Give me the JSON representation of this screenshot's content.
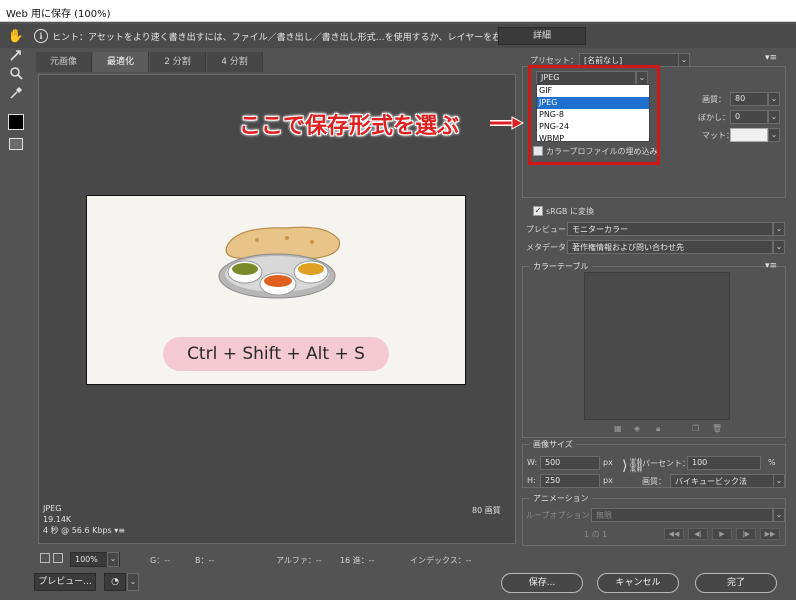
{
  "window": {
    "title": "Web 用に保存 (100%)"
  },
  "hint": {
    "text": "ヒント：アセットをより速く書き出すには、ファイル／書き出し／書き出し形式…を使用するか、レイヤーを右クリックして使用。",
    "detail_button": "詳細"
  },
  "tabs": [
    "元画像",
    "最適化",
    "2 分割",
    "4 分割"
  ],
  "preview": {
    "shortcut_text": "Ctrl + Shift + Alt + S"
  },
  "image_info": {
    "format": "JPEG",
    "size": "19.14K",
    "speed": "4 秒 @ 56.6 Kbps",
    "quality": "80 画質"
  },
  "callout": {
    "text": "ここで保存形式を選ぶ",
    "color": "#e02020"
  },
  "settings": {
    "preset_label": "プリセット：",
    "preset_value": "[名前なし]",
    "format_value": "JPEG",
    "format_options": [
      "GIF",
      "JPEG",
      "PNG-8",
      "PNG-24",
      "WBMP"
    ],
    "quality_label": "画質：",
    "quality_value": "80",
    "blur_label": "ぼかし：",
    "blur_value": "0",
    "matte_label": "マット：",
    "embed_profile_label": "カラープロファイルの埋め込み",
    "srgb_label": "sRGB に変換",
    "preview_label": "プレビュー：",
    "preview_value": "モニターカラー",
    "metadata_label": "メタデータ：",
    "metadata_value": "著作権情報および問い合わせ先"
  },
  "color_table": {
    "title": "カラーテーブル"
  },
  "image_size": {
    "title": "画像サイズ",
    "w_label": "W:",
    "w_value": "500",
    "w_unit": "px",
    "h_label": "H:",
    "h_value": "250",
    "h_unit": "px",
    "percent_label": "パーセント：",
    "percent_value": "100",
    "percent_unit": "%",
    "quality_label": "画質：",
    "quality_value": "バイキュービック法"
  },
  "animation": {
    "title": "アニメーション",
    "loop_label": "ループオプション：",
    "loop_value": "無限",
    "frame": "1 の 1"
  },
  "status": {
    "zoom": "100%",
    "g": "G：--",
    "b": "B：--",
    "alpha": "アルファ：--",
    "hex": "16 進：--",
    "index": "インデックス：--"
  },
  "buttons": {
    "preview": "プレビュー...",
    "save": "保存...",
    "cancel": "キャンセル",
    "done": "完了"
  },
  "colors": {
    "highlight": "#d01818",
    "selection": "#1e6fd0",
    "shortcut_bg": "#f4c9cf"
  }
}
